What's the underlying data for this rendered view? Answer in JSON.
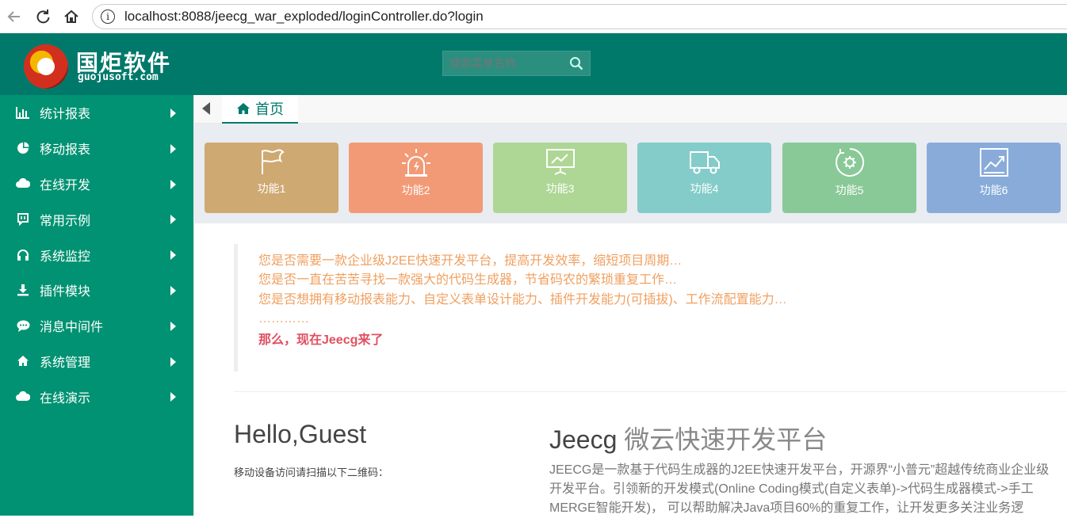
{
  "browser": {
    "url": "localhost:8088/jeecg_war_exploded/loginController.do?login",
    "info_icon": "info-icon"
  },
  "header": {
    "logo_cn": "国炬软件",
    "logo_en": "guojusoft.com",
    "search_placeholder": "搜索菜单名称",
    "bg_color": "#00796b"
  },
  "sidebar": {
    "bg_color": "#009272",
    "items": [
      {
        "label": "统计报表",
        "icon": "bar-chart-icon"
      },
      {
        "label": "移动报表",
        "icon": "pie-chart-icon"
      },
      {
        "label": "在线开发",
        "icon": "cloud-icon"
      },
      {
        "label": "常用示例",
        "icon": "chat-bubble-icon"
      },
      {
        "label": "系统监控",
        "icon": "headphones-icon"
      },
      {
        "label": "插件模块",
        "icon": "download-icon"
      },
      {
        "label": "消息中间件",
        "icon": "comment-icon"
      },
      {
        "label": "系统管理",
        "icon": "home-icon"
      },
      {
        "label": "在线演示",
        "icon": "cloud-icon"
      }
    ]
  },
  "tabs": {
    "home_label": "首页"
  },
  "tiles": [
    {
      "label": "功能1",
      "color": "#cfa972",
      "icon": "flag-icon"
    },
    {
      "label": "功能2",
      "color": "#f29a76",
      "icon": "alarm-light-icon"
    },
    {
      "label": "功能3",
      "color": "#aed695",
      "icon": "presentation-icon"
    },
    {
      "label": "功能4",
      "color": "#84ccc9",
      "icon": "truck-icon"
    },
    {
      "label": "功能5",
      "color": "#89c997",
      "icon": "gear-circle-icon"
    },
    {
      "label": "功能6",
      "color": "#88abda",
      "icon": "trend-chart-icon"
    }
  ],
  "intro": {
    "lines": [
      "您是否需要一款企业级J2EE快速开发平台，提高开发效率，缩短项目周期…",
      "您是否一直在苦苦寻找一款强大的代码生成器，节省码农的繁琐重复工作…",
      "您是否想拥有移动报表能力、自定义表单设计能力、插件开发能力(可插拔)、工作流配置能力…",
      "…………"
    ],
    "final": "那么，现在Jeecg来了"
  },
  "hello": {
    "title": "Hello,Guest",
    "qr_hint": "移动设备访问请扫描以下二维码："
  },
  "jeecg": {
    "title_main": "Jeecg",
    "title_sub": "微云快速开发平台",
    "desc": "JEECG是一款基于代码生成器的J2EE快速开发平台，开源界“小普元”超越传统商业企业级开发平台。引领新的开发模式(Online Coding模式(自定义表单)->代码生成器模式->手工MERGE智能开发)， 可以帮助解决Java项目60%的重复工作，让开发更多关注业务逻"
  }
}
